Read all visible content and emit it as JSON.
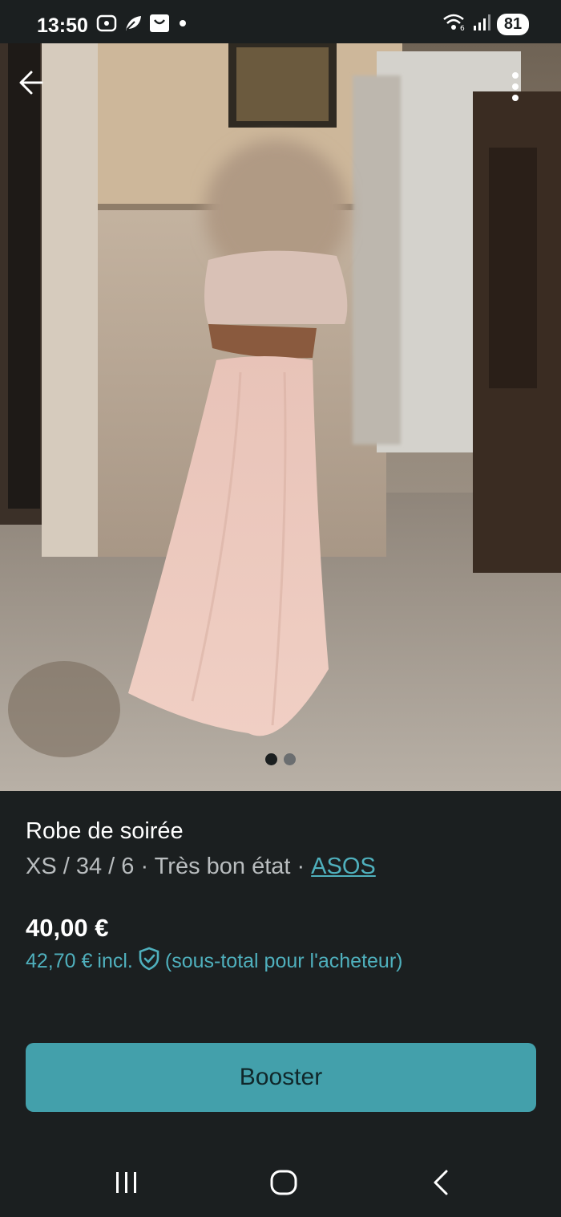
{
  "status_bar": {
    "time": "13:50",
    "battery": "81",
    "icons_left": [
      "screenshot-icon",
      "leaf-icon",
      "shopping-bag-icon",
      "dot-icon"
    ],
    "icons_right": [
      "wifi-icon",
      "signal-icon",
      "battery-icon"
    ]
  },
  "photo": {
    "page_count": 2,
    "active_page": 1
  },
  "item": {
    "title": "Robe de soirée",
    "meta_prefix": "XS / 34 / 6 · Très bon état ·",
    "brand": "ASOS",
    "price": "40,00 €",
    "buyer_price": "42,70 €",
    "buyer_incl": "incl.",
    "buyer_note": "(sous-total pour l'acheteur)"
  },
  "actions": {
    "booster_label": "Booster"
  },
  "colors": {
    "background": "#1b1f20",
    "accent": "#43a0ab",
    "link": "#4fb0bd"
  }
}
